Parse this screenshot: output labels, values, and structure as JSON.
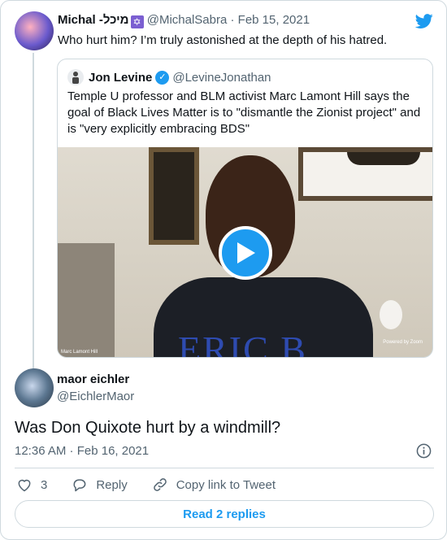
{
  "parent_tweet": {
    "name": "Michal -מיכל",
    "star_glyph": "✡",
    "handle": "@MichalSabra",
    "date": "Feb 15, 2021",
    "separator": " · ",
    "text": "Who hurt him? I’m truly astonished at the depth of his hatred."
  },
  "quoted_tweet": {
    "name": "Jon Levine",
    "verified_glyph": "✓",
    "handle": "@LevineJonathan",
    "text": "Temple U professor and BLM activist Marc Lamont Hill says the goal of Black Lives Matter is to \"dismantle the Zionist project\" and is \"very explicitly embracing BDS\"",
    "video": {
      "shirt_text": "ERIC B",
      "caption": "Marc Lamont Hill",
      "watermark": "Powered by Zoom"
    }
  },
  "reply_tweet": {
    "name": "maor eichler",
    "handle": "@EichlerMaor",
    "text": "Was Don Quixote hurt by a windmill?",
    "timestamp": "12:36 AM · Feb 16, 2021"
  },
  "actions": {
    "like_count": "3",
    "reply_label": "Reply",
    "copy_label": "Copy link to Tweet"
  },
  "read_replies_label": "Read 2 replies",
  "colors": {
    "accent": "#1d9bf0",
    "secondary_text": "#536471",
    "border": "#cfd9de"
  },
  "icons": [
    "twitter-bird-icon",
    "verified-badge-icon",
    "play-icon",
    "info-icon",
    "heart-icon",
    "reply-icon",
    "link-icon"
  ]
}
